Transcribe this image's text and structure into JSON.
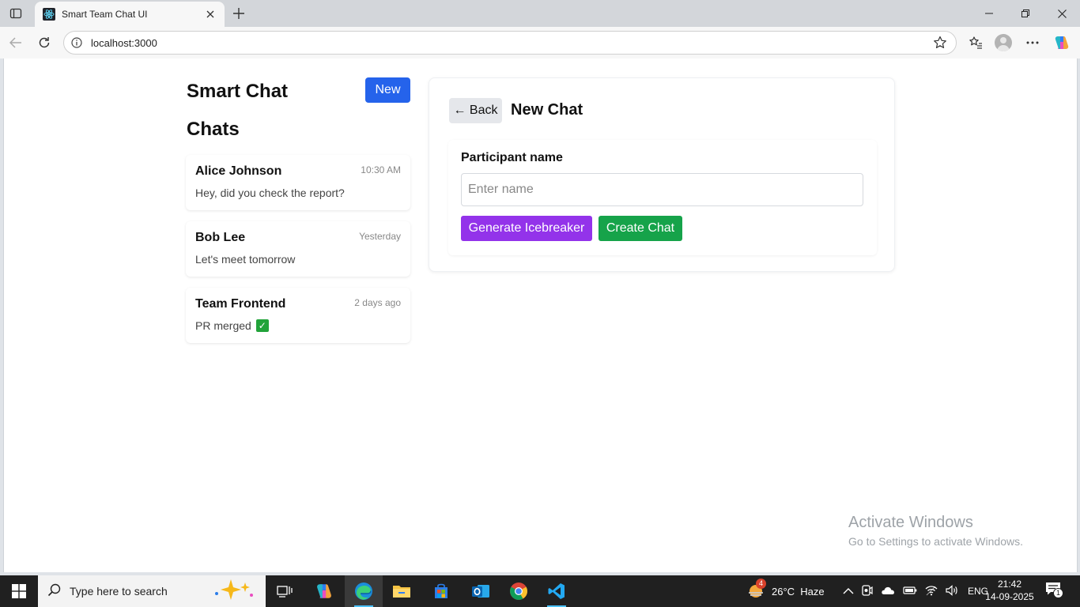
{
  "browser": {
    "tab_title": "Smart Team Chat UI",
    "url": "localhost:3000"
  },
  "app": {
    "title": "Smart Chat",
    "new_label": "New",
    "chats_heading": "Chats"
  },
  "chats": [
    {
      "name": "Alice Johnson",
      "time": "10:30 AM",
      "preview": "Hey, did you check the report?"
    },
    {
      "name": "Bob Lee",
      "time": "Yesterday",
      "preview": "Let's meet tomorrow"
    },
    {
      "name": "Team Frontend",
      "time": "2 days ago",
      "preview": "PR merged"
    }
  ],
  "panel": {
    "back_label": "← Back",
    "title": "New Chat",
    "field_label": "Participant name",
    "input_placeholder": "Enter name",
    "input_value": "",
    "icebreaker_label": "Generate Icebreaker",
    "create_label": "Create Chat"
  },
  "watermark": {
    "title": "Activate Windows",
    "subtitle": "Go to Settings to activate Windows."
  },
  "taskbar": {
    "search_placeholder": "Type here to search",
    "weather": "26°C  Haze",
    "weather_badge": "4",
    "language": "ENG",
    "time": "21:42",
    "date": "14-09-2025",
    "notification_count": "1"
  },
  "colors": {
    "primary_blue": "#2563eb",
    "purple": "#9333ea",
    "green": "#16a34a"
  }
}
